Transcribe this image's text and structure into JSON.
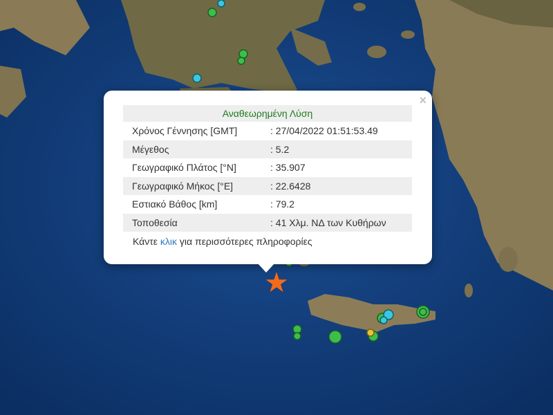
{
  "popup": {
    "close": "×",
    "title": "Αναθεωρημένη Λύση",
    "rows": [
      {
        "label": "Χρόνος Γέννησης [GMT]",
        "value": ": 27/04/2022 01:51:53.49"
      },
      {
        "label": "Μέγεθος",
        "value": ": 5.2"
      },
      {
        "label": "Γεωγραφικό Πλάτος [°N]",
        "value": ": 35.907"
      },
      {
        "label": "Γεωγραφικό Μήκος [°E]",
        "value": ": 22.6428"
      },
      {
        "label": "Εστιακό Βάθος [km]",
        "value": ": 79.2"
      },
      {
        "label": "Τοποθεσία",
        "value": ": 41 Χλμ. ΝΔ των Κυθήρων"
      }
    ],
    "more_prefix": "Κάντε ",
    "more_link": "κλικ",
    "more_suffix": " για περισσότερες πληροφορίες"
  },
  "epicenter_icon": "star-icon",
  "colors": {
    "sea": "#0f3b78",
    "land": "#7d6f4e",
    "star": "#f26b1d",
    "marker_green": "#3cbf4a",
    "marker_cyan": "#38c8e0",
    "title_text": "#1f7a1f"
  }
}
